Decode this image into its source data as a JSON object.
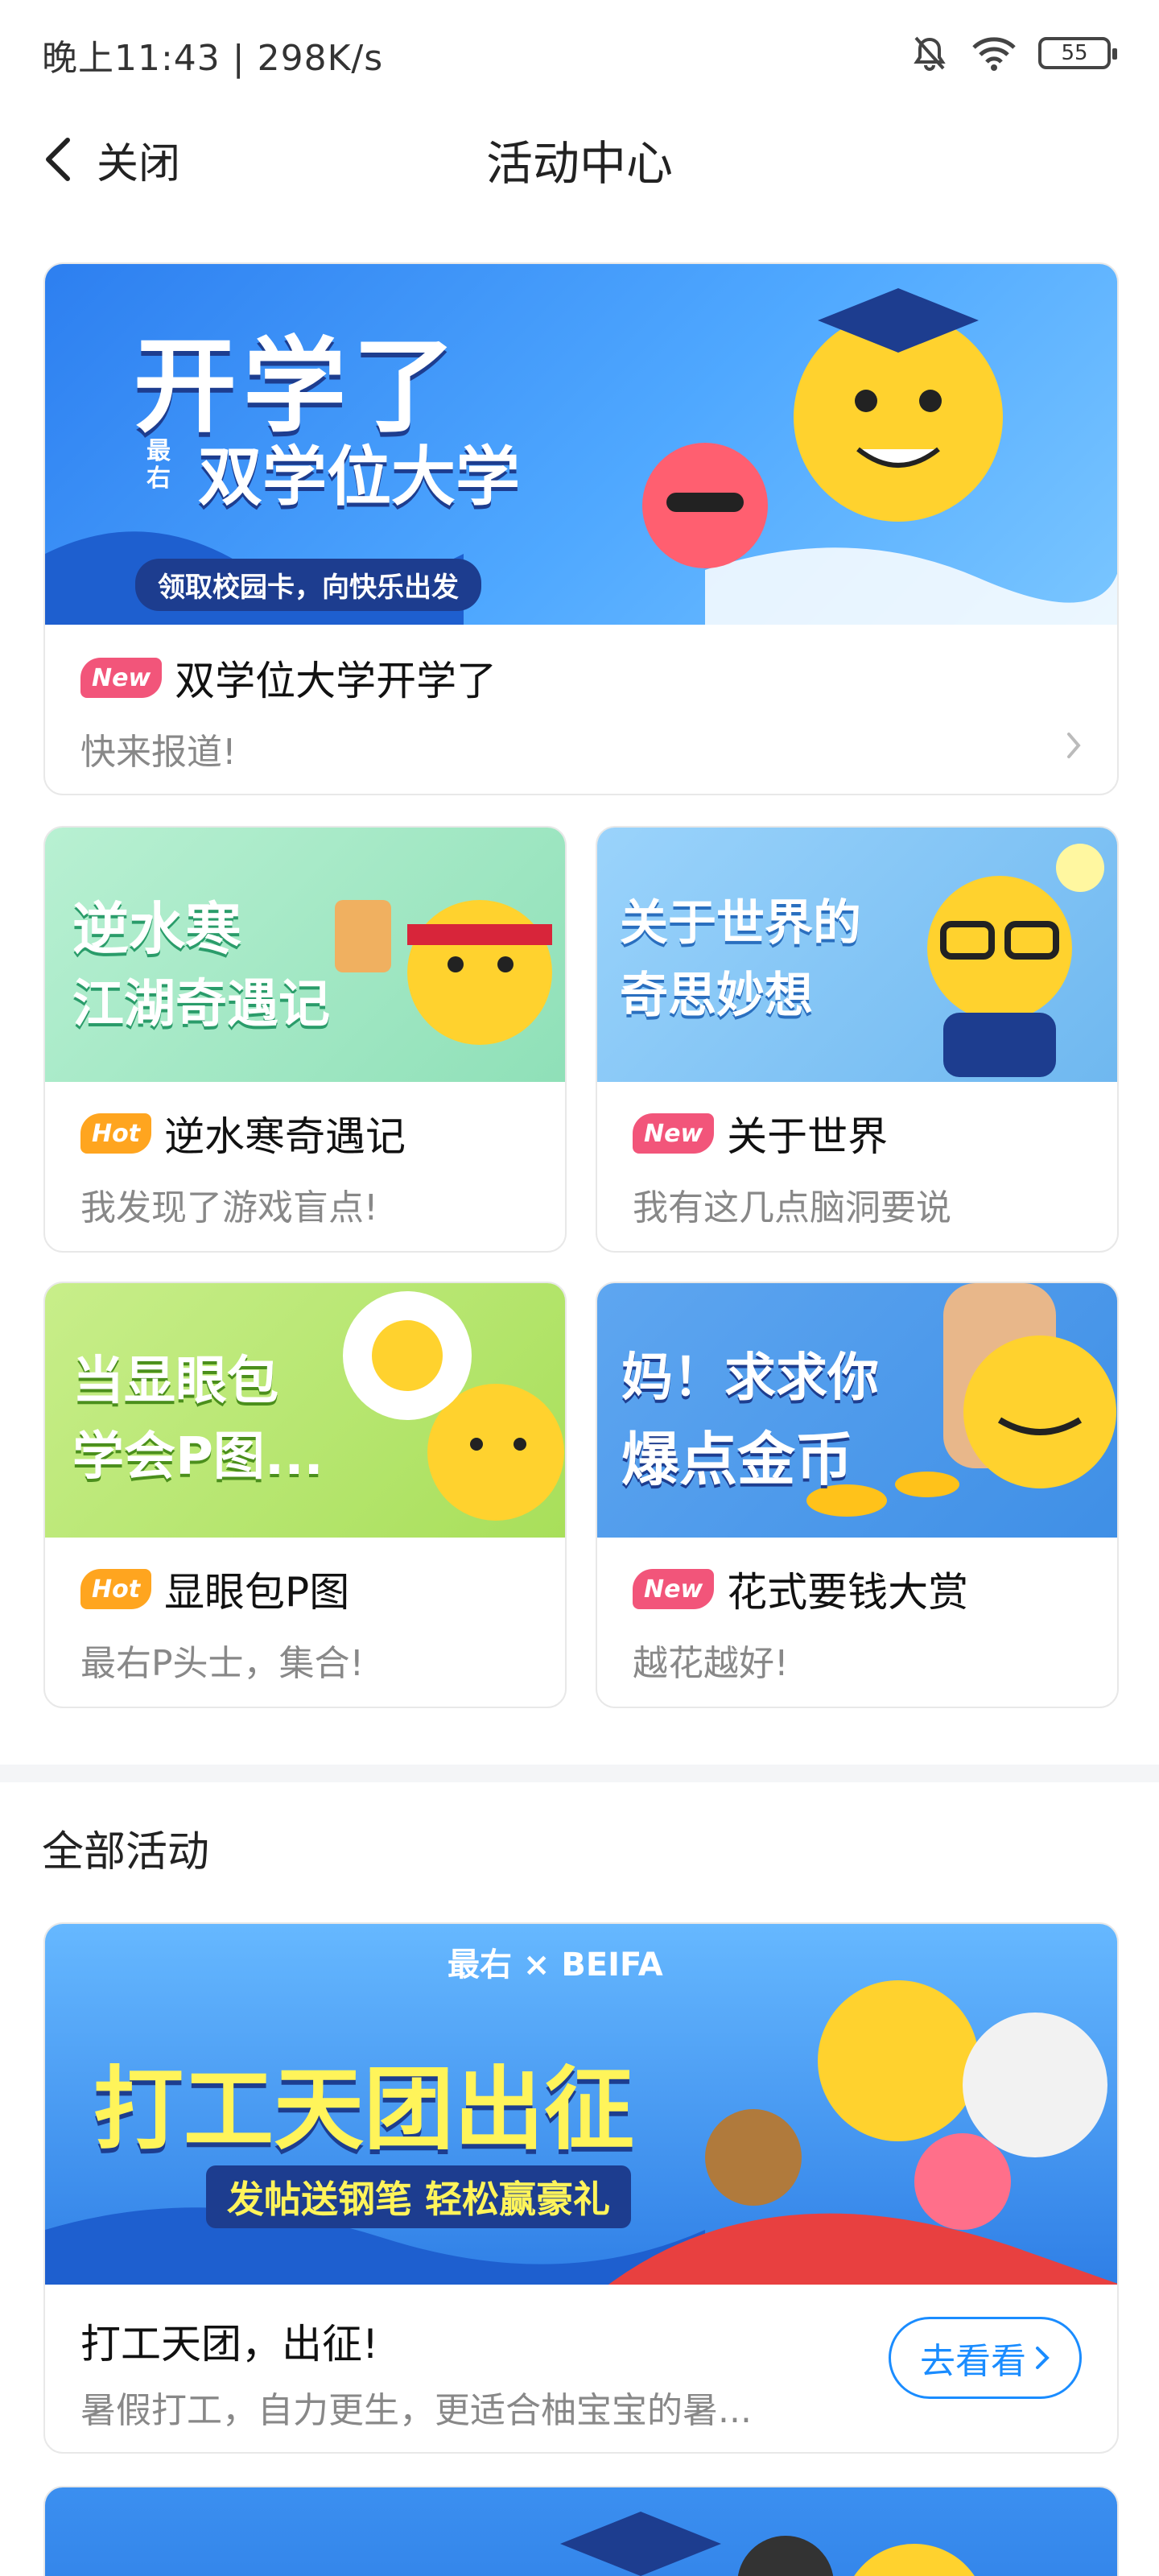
{
  "status_bar": {
    "text": "晚上11:43 | 298K/s",
    "battery": "55"
  },
  "nav": {
    "back_label": "关闭",
    "title": "活动中心"
  },
  "featured": {
    "banner_title": "开学了",
    "banner_brand": "最右",
    "banner_subtitle": "双学位大学",
    "banner_slogan": "领取校园卡，向快乐出发",
    "badge": "New",
    "title": "双学位大学开学了",
    "subtitle": "快来报道!"
  },
  "grid": [
    {
      "banner_line1": "逆水寒",
      "banner_line2": "江湖奇遇记",
      "badge": "Hot",
      "badge_type": "hot",
      "title": "逆水寒奇遇记",
      "subtitle": "我发现了游戏盲点!",
      "accent": "#8fe0b8"
    },
    {
      "banner_line1": "关于世界的",
      "banner_line2": "奇思妙想",
      "badge": "New",
      "badge_type": "new",
      "title": "关于世界",
      "subtitle": "我有这几点脑洞要说",
      "accent": "#6fb8f0"
    },
    {
      "banner_line1": "当显眼包",
      "banner_line2": "学会P图...",
      "badge": "Hot",
      "badge_type": "hot",
      "title": "显眼包P图",
      "subtitle": "最右P头士，集合!",
      "accent": "#a8df5a"
    },
    {
      "banner_line1": "妈！求求你",
      "banner_line2": "爆点金币",
      "badge": "New",
      "badge_type": "new",
      "title": "花式要钱大赏",
      "subtitle": "越花越好!",
      "accent": "#3f8fe6"
    }
  ],
  "section": {
    "title": "全部活动"
  },
  "all_activities": [
    {
      "banner_brand": "最右 × BEIFA",
      "banner_title": "打工天团出征",
      "banner_slogan": "发帖送钢笔 轻松赢豪礼",
      "title": "打工天团，出征!",
      "subtitle": "暑假打工，自力更生，更适合柚宝宝的暑...",
      "button": "去看看"
    }
  ],
  "colors": {
    "new_badge": "#f2557a",
    "hot_badge": "#ffa51f",
    "link_blue": "#1a8cff"
  }
}
